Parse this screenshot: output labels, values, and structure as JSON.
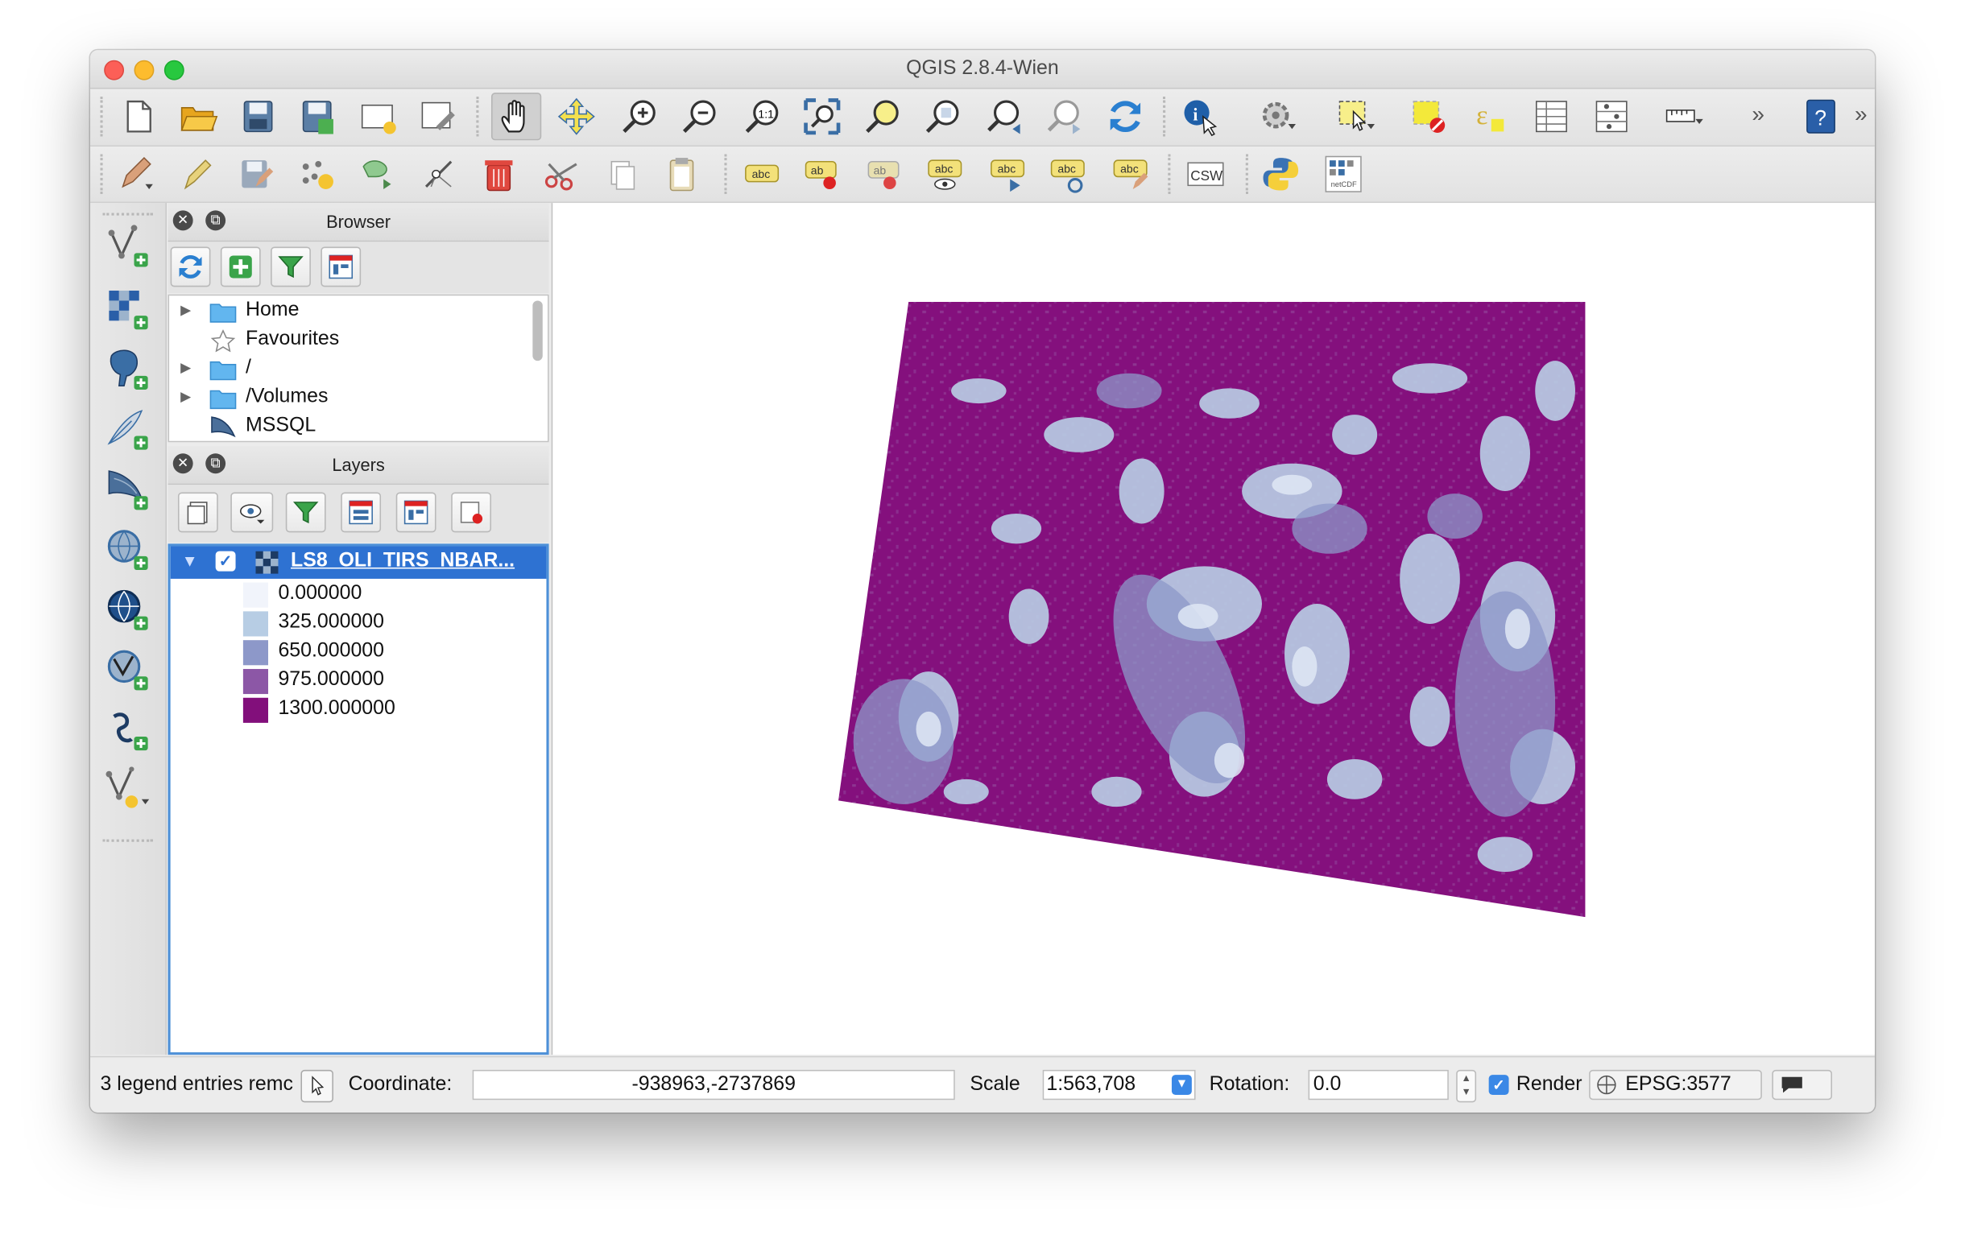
{
  "window": {
    "title": "QGIS 2.8.4-Wien"
  },
  "toolbar": {
    "row1": [
      "new-project-icon",
      "open-project-icon",
      "save-project-icon",
      "save-as-icon",
      "new-print-composer-icon",
      "composer-manager-icon",
      "pan-hand-icon",
      "pan-to-selection-icon",
      "zoom-in-icon",
      "zoom-out-icon",
      "zoom-actual-size-icon",
      "zoom-full-icon",
      "zoom-to-selection-icon",
      "zoom-to-layer-icon",
      "zoom-last-icon",
      "zoom-next-icon",
      "refresh-icon",
      "identify-icon",
      "action-gear-icon",
      "select-features-icon",
      "deselect-icon",
      "field-calculator-icon",
      "attribute-table-icon",
      "statistics-icon",
      "measure-icon",
      "overflow-chevron-icon",
      "help-icon"
    ],
    "row2": [
      "toggle-editing-icon",
      "current-edits-icon",
      "save-edits-icon",
      "add-feature-icon",
      "move-feature-icon",
      "node-tool-icon",
      "delete-selected-icon",
      "cut-features-icon",
      "copy-features-icon",
      "paste-features-icon",
      "label-layer-icon",
      "pin-labels-icon",
      "highlight-pinned-labels-icon",
      "show-hide-labels-icon",
      "move-label-icon",
      "rotate-label-icon",
      "change-label-icon",
      "csw-icon",
      "python-icon",
      "netcdf-icon"
    ]
  },
  "browser": {
    "title": "Browser",
    "items": [
      {
        "label": "Home",
        "icon": "folder-icon",
        "expandable": true
      },
      {
        "label": "Favourites",
        "icon": "star-icon",
        "expandable": false
      },
      {
        "label": "/",
        "icon": "folder-icon",
        "expandable": true
      },
      {
        "label": "/Volumes",
        "icon": "folder-icon",
        "expandable": true
      },
      {
        "label": "MSSQL",
        "icon": "mssql-icon",
        "expandable": false
      }
    ]
  },
  "layers": {
    "title": "Layers",
    "layer": {
      "name": "LS8_OLI_TIRS_NBAR...",
      "checked": true
    },
    "legend": [
      {
        "value": "0.000000",
        "color": "#f1f4fb"
      },
      {
        "value": "325.000000",
        "color": "#b7cde4"
      },
      {
        "value": "650.000000",
        "color": "#8d98c9"
      },
      {
        "value": "975.000000",
        "color": "#8c57a6"
      },
      {
        "value": "1300.000000",
        "color": "#820f7b"
      }
    ]
  },
  "status": {
    "message": "3 legend entries remc",
    "coordinate_label": "Coordinate:",
    "coordinate_value": "-938963,-2737869",
    "scale_label": "Scale",
    "scale_value": "1:563,708",
    "rotation_label": "Rotation:",
    "rotation_value": "0.0",
    "render_label": "Render",
    "render_checked": true,
    "crs": "EPSG:3577"
  },
  "colors": {
    "raster_main": "#84107d",
    "raster_light": "#b8cde4",
    "selection_blue": "#2e72d2"
  }
}
